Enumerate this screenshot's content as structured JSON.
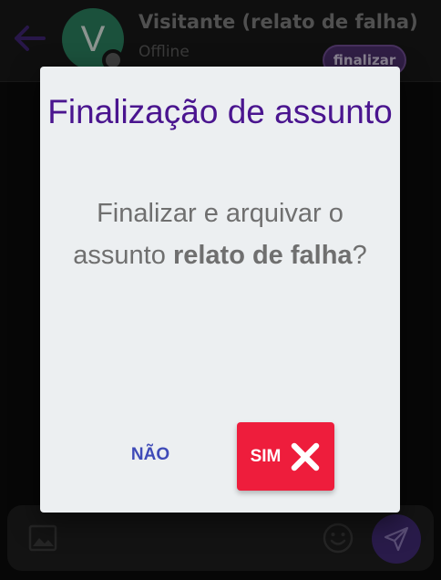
{
  "header": {
    "back_icon": "arrow-left-icon",
    "avatar_letter": "V",
    "contact_name": "Visitante (relato de falha)",
    "contact_status": "Offline",
    "finalize_label": "finalizar"
  },
  "input_bar": {
    "image_icon": "image-icon",
    "message_placeholder": "",
    "emoji_icon": "emoji-icon",
    "send_icon": "send-icon"
  },
  "modal": {
    "title": "Finalização de assunto",
    "message_before": "Finalizar e arquivar o assunto ",
    "message_bold": "relato de falha",
    "message_after": "?",
    "no_label": "NÃO",
    "yes_label": "SIM",
    "yes_icon": "close-icon"
  },
  "colors": {
    "accent_purple": "#4a158f",
    "confirm_red": "#ee1d3c",
    "cancel_blue": "#3f4bb8",
    "modal_background": "#eceff1"
  }
}
